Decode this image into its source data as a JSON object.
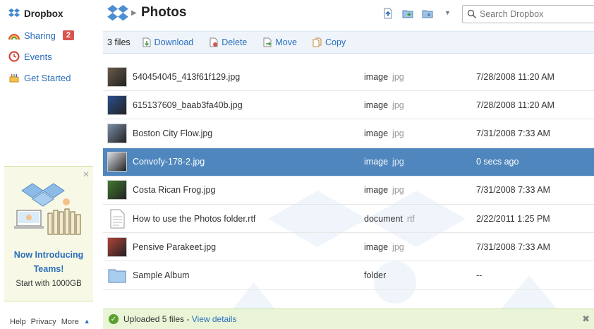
{
  "sidebar": {
    "brand": "Dropbox",
    "items": [
      {
        "label": "Sharing",
        "badge": "2"
      },
      {
        "label": "Events"
      },
      {
        "label": "Get Started"
      }
    ],
    "promo": {
      "title_line1": "Now Introducing",
      "title_line2": "Teams!",
      "subtitle": "Start with 1000GB"
    },
    "footer": {
      "help": "Help",
      "privacy": "Privacy",
      "more": "More"
    }
  },
  "header": {
    "title": "Photos",
    "search_placeholder": "Search Dropbox"
  },
  "toolbar": {
    "count": "3 files",
    "download": "Download",
    "delete": "Delete",
    "move": "Move",
    "copy": "Copy"
  },
  "files": [
    {
      "name": "540454045_413f61f129.jpg",
      "type": "image",
      "ext": "jpg",
      "date": "7/28/2008 11:20 AM",
      "thumb_color": "#6b5a4a"
    },
    {
      "name": "615137609_baab3fa40b.jpg",
      "type": "image",
      "ext": "jpg",
      "date": "7/28/2008 11:20 AM",
      "thumb_color": "#2c4f8f"
    },
    {
      "name": "Boston City Flow.jpg",
      "type": "image",
      "ext": "jpg",
      "date": "7/31/2008 7:33 AM",
      "thumb_color": "#7a8ea8"
    },
    {
      "name": "Convofy-178-2.jpg",
      "type": "image",
      "ext": "jpg",
      "date": "0 secs ago",
      "thumb_color": "#d9dde2",
      "selected": true
    },
    {
      "name": "Costa Rican Frog.jpg",
      "type": "image",
      "ext": "jpg",
      "date": "7/31/2008 7:33 AM",
      "thumb_color": "#3f7a2f"
    },
    {
      "name": "How to use the Photos folder.rtf",
      "type": "document",
      "ext": "rtf",
      "date": "2/22/2011 1:25 PM",
      "icon": "document-icon"
    },
    {
      "name": "Pensive Parakeet.jpg",
      "type": "image",
      "ext": "jpg",
      "date": "7/31/2008 7:33 AM",
      "thumb_color": "#b2423a"
    },
    {
      "name": "Sample Album",
      "type": "folder",
      "ext": "",
      "date": "--",
      "icon": "folder-icon"
    }
  ],
  "notification": {
    "message": "Uploaded 5 files - ",
    "link": "View details"
  },
  "colors": {
    "accent": "#2a6ebb",
    "selected_row": "#4f86bd",
    "badge": "#d9534f",
    "notify_bg": "#eaf5d8"
  }
}
